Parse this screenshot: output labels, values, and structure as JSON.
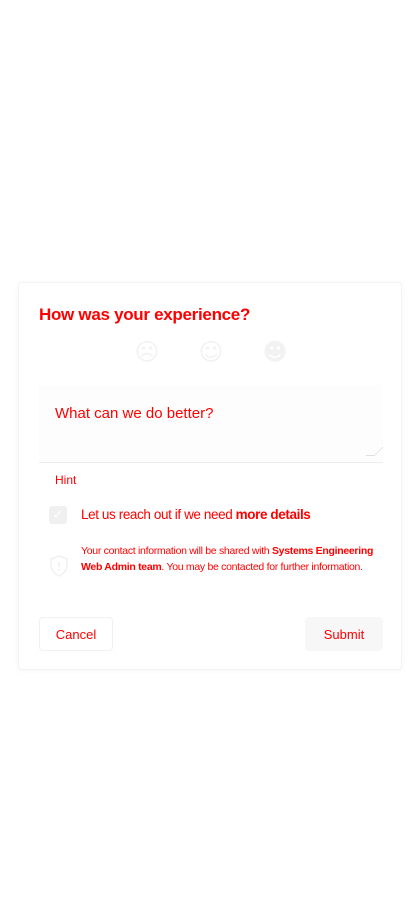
{
  "dialog": {
    "title": "How was your experience?",
    "rating": {
      "options": [
        {
          "icon": "sad-face-icon",
          "glyph": "☹"
        },
        {
          "icon": "neutral-face-icon",
          "glyph": "☺"
        },
        {
          "icon": "happy-face-icon",
          "glyph": "☻"
        }
      ]
    },
    "feedback": {
      "placeholder": "What can we do better?",
      "value": ""
    },
    "hint": "Hint",
    "consent": {
      "checked": true,
      "label_prefix": "Let us reach out if we need ",
      "label_bold": "more details"
    },
    "info": {
      "icon": "shield-icon",
      "text_prefix": "Your contact information will be shared with ",
      "text_bold": "Systems Engineering Web Admin team",
      "text_suffix": ". You may be contacted for further information."
    },
    "buttons": {
      "cancel": "Cancel",
      "submit": "Submit"
    }
  },
  "colors": {
    "text": "#ff0000",
    "background": "#ffffff"
  }
}
